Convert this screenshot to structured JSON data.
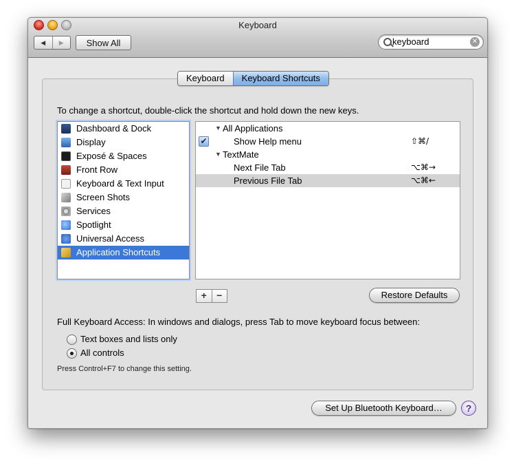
{
  "window": {
    "title": "Keyboard",
    "show_all_label": "Show All",
    "nav_back_icon": "◀",
    "nav_forward_icon": "▶"
  },
  "search": {
    "value": "keyboard",
    "clear_icon": "✕"
  },
  "tabs": [
    {
      "label": "Keyboard",
      "selected": false
    },
    {
      "label": "Keyboard Shortcuts",
      "selected": true
    }
  ],
  "instructions": "To change a shortcut, double-click the shortcut and hold down the new keys.",
  "categories": [
    {
      "label": "Dashboard & Dock",
      "icon": "dashboard-icon"
    },
    {
      "label": "Display",
      "icon": "display-icon"
    },
    {
      "label": "Exposé & Spaces",
      "icon": "expose-icon"
    },
    {
      "label": "Front Row",
      "icon": "front-row-icon"
    },
    {
      "label": "Keyboard & Text Input",
      "icon": "keyboard-icon"
    },
    {
      "label": "Screen Shots",
      "icon": "screen-shots-icon"
    },
    {
      "label": "Services",
      "icon": "services-icon"
    },
    {
      "label": "Spotlight",
      "icon": "spotlight-icon"
    },
    {
      "label": "Universal Access",
      "icon": "universal-access-icon"
    },
    {
      "label": "Application Shortcuts",
      "icon": "application-shortcuts-icon",
      "selected": true
    }
  ],
  "shortcuts": [
    {
      "label": "All Applications",
      "type": "group",
      "disclosure": "▼"
    },
    {
      "label": "Show Help menu",
      "type": "item",
      "checked": true,
      "check_glyph": "✔",
      "keys": "⇧⌘/"
    },
    {
      "label": "TextMate",
      "type": "group",
      "disclosure": "▼"
    },
    {
      "label": "Next File Tab",
      "type": "item",
      "keys": "⌥⌘→"
    },
    {
      "label": "Previous File Tab",
      "type": "item",
      "keys": "⌥⌘←",
      "selected": true
    }
  ],
  "buttons": {
    "add": "+",
    "remove": "−",
    "restore_defaults": "Restore Defaults",
    "bluetooth": "Set Up Bluetooth Keyboard…",
    "help": "?"
  },
  "full_keyboard_access": {
    "label": "Full Keyboard Access: In windows and dialogs, press Tab to move keyboard focus between:",
    "options": [
      {
        "label": "Text boxes and lists only",
        "selected": false
      },
      {
        "label": "All controls",
        "selected": true
      }
    ],
    "hint": "Press Control+F7 to change this setting."
  },
  "colors": {
    "selection": "#3b78d8",
    "row_selected": "#d4d4d4",
    "tab_active": "#93bde9"
  }
}
